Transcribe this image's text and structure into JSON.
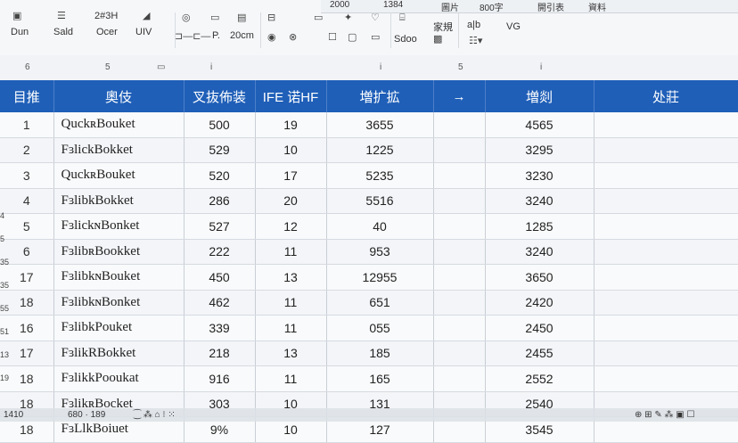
{
  "ribbon": {
    "top_items": [
      "2000",
      "1384",
      "圖片",
      "800字",
      "開引表",
      "資料"
    ],
    "groups": [
      {
        "icon": "clipboard-icon",
        "label": "Dun"
      },
      {
        "icon": "stack-icon",
        "label": "Sald"
      },
      {
        "icon": "",
        "label": "Ocer",
        "caption": "2#3H"
      },
      {
        "icon": "chart-icon",
        "label": "UIV"
      }
    ],
    "format_row": [
      "P.",
      "20cm"
    ],
    "misc_labels": [
      "家規",
      "Sdoo",
      "VG",
      "a|b"
    ]
  },
  "column_markers": [
    "6",
    "5",
    "",
    "i",
    "",
    "i",
    "5",
    "i"
  ],
  "table": {
    "headers": [
      "目推",
      "奧伎",
      "叉抜佈装",
      "IFE 诺HF",
      "増扩拡",
      "→",
      "増剡",
      "处莊"
    ],
    "rows": [
      {
        "idx": "1",
        "name": "QuckʀBouket",
        "a": "500",
        "b": "19",
        "c": "3655",
        "d": "",
        "e": "4565",
        "f": ""
      },
      {
        "idx": "2",
        "name": "FɜlickBokket",
        "a": "529",
        "b": "10",
        "c": "1225",
        "d": "",
        "e": "3295",
        "f": ""
      },
      {
        "idx": "3",
        "name": "QuckʀBouket",
        "a": "520",
        "b": "17",
        "c": "5235",
        "d": "",
        "e": "3230",
        "f": ""
      },
      {
        "idx": "4",
        "name": "FɜlibkBokket",
        "a": "286",
        "b": "20",
        "c": "5516",
        "d": "",
        "e": "3240",
        "f": ""
      },
      {
        "idx": "5",
        "name": "FɜlickɴBonket",
        "a": "527",
        "b": "12",
        "c": "40",
        "d": "",
        "e": "1285",
        "f": ""
      },
      {
        "idx": "6",
        "name": "FɜlibʀBookket",
        "a": "222",
        "b": "11",
        "c": "953",
        "d": "",
        "e": "3240",
        "f": ""
      },
      {
        "idx": "17",
        "name": "FɜlibkɴBouket",
        "a": "450",
        "b": "13",
        "c": "12955",
        "d": "",
        "e": "3650",
        "f": ""
      },
      {
        "idx": "18",
        "name": "FɜlibkɴBonket",
        "a": "462",
        "b": "11",
        "c": "651",
        "d": "",
        "e": "2420",
        "f": ""
      },
      {
        "idx": "16",
        "name": "FɜlibkPouket",
        "a": "339",
        "b": "11",
        "c": "055",
        "d": "",
        "e": "2450",
        "f": ""
      },
      {
        "idx": "17",
        "name": "FɜlikRBokket",
        "a": "218",
        "b": "13",
        "c": "185",
        "d": "",
        "e": "2455",
        "f": ""
      },
      {
        "idx": "18",
        "name": "FɜlikkPooukat",
        "a": "916",
        "b": "11",
        "c": "165",
        "d": "",
        "e": "2552",
        "f": ""
      },
      {
        "idx": "18",
        "name": "FɜlikʀBocket",
        "a": "303",
        "b": "10",
        "c": "131",
        "d": "",
        "e": "2540",
        "f": ""
      },
      {
        "idx": "18",
        "name": "FɜLlkBoiuet",
        "a": "9%",
        "b": "10",
        "c": "127",
        "d": "",
        "e": "3545",
        "f": ""
      }
    ]
  },
  "row_headers": [
    "",
    "",
    "",
    "",
    "",
    "4",
    "5",
    "35",
    "35",
    "55",
    "51",
    "13",
    "19"
  ],
  "status": {
    "left": "1410",
    "count": "680 · 189",
    "mid": "⁐ ⁂ ⌂ ⁝ ⁙",
    "right": "⊕ ⊞ ✎ ⁂ ▣ ☐"
  }
}
